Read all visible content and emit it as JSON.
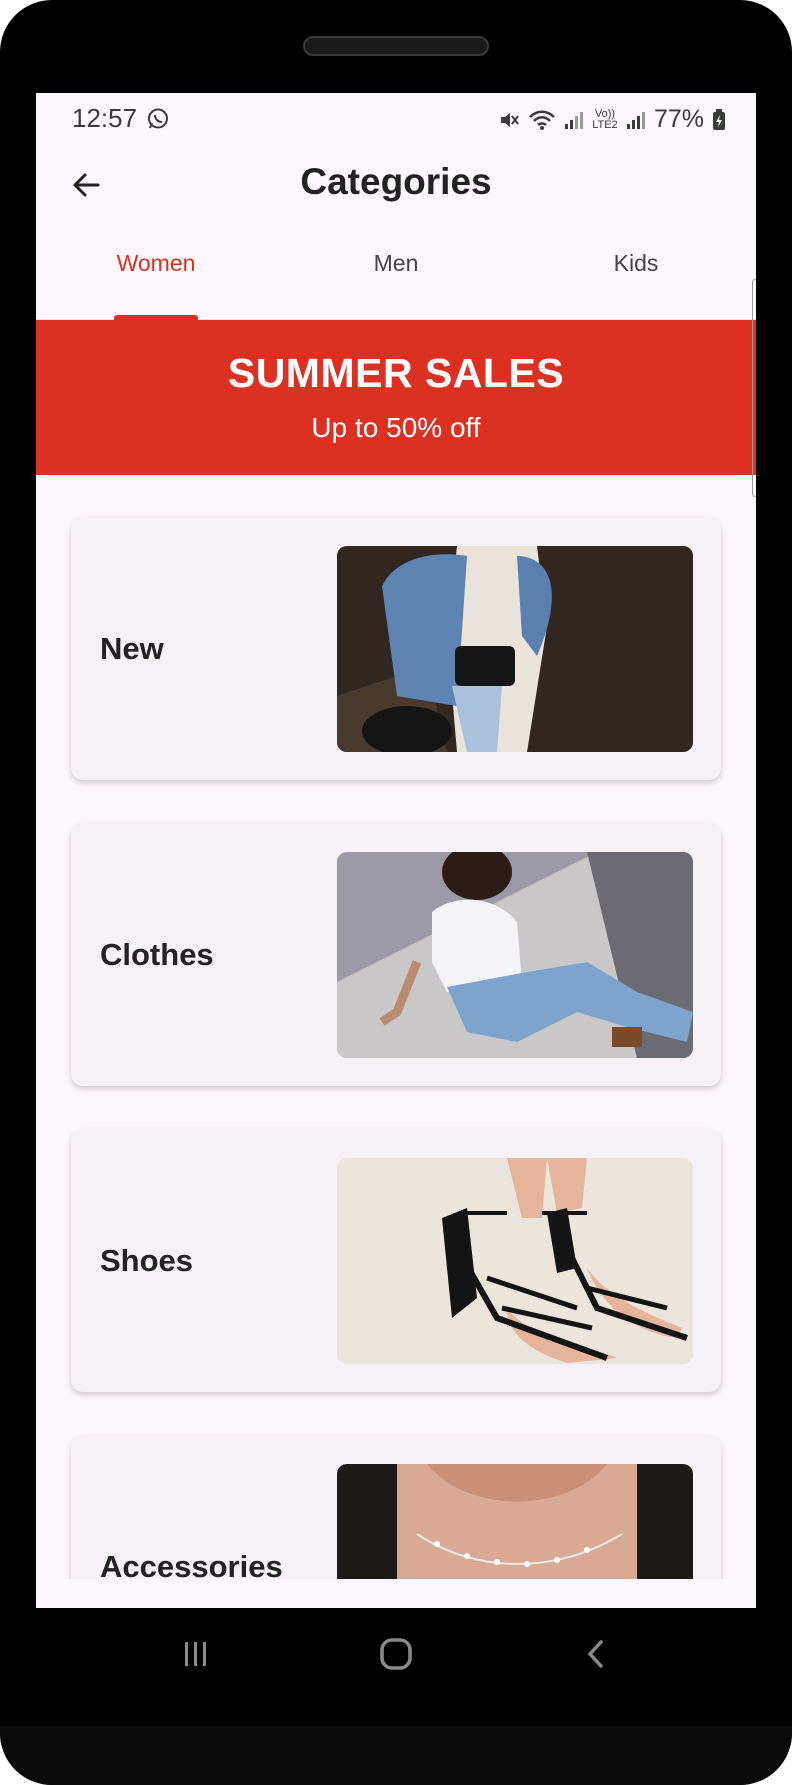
{
  "status_bar": {
    "time": "12:57",
    "battery": "77%",
    "icons": [
      "whatsapp-icon",
      "mute-icon",
      "wifi-icon",
      "signal-icon",
      "volte-icon",
      "battery-icon"
    ],
    "volte_text": "Vo)) LTE2"
  },
  "app_bar": {
    "title": "Categories",
    "back_icon": "arrow-left-icon"
  },
  "tabs": [
    {
      "label": "Women",
      "active": true
    },
    {
      "label": "Men",
      "active": false
    },
    {
      "label": "Kids",
      "active": false
    }
  ],
  "banner": {
    "title": "SUMMER SALES",
    "subtitle": "Up to 50% off"
  },
  "categories": [
    {
      "label": "New"
    },
    {
      "label": "Clothes"
    },
    {
      "label": "Shoes"
    },
    {
      "label": "Accessories"
    }
  ],
  "nav_bar": {
    "icons": [
      "recent-apps-icon",
      "home-icon",
      "back-icon"
    ]
  },
  "colors": {
    "accent": "#db3022",
    "background": "#fcf7fc",
    "card": "#f5f1f6"
  }
}
